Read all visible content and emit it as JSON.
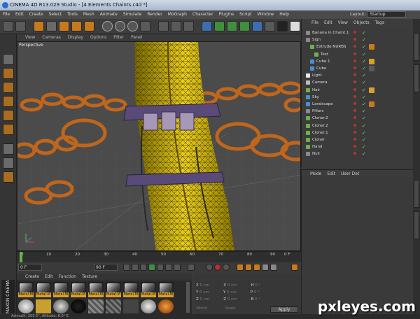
{
  "window": {
    "title": "CINEMA 4D R13.029 Studio - [4 Elements Chaints.c4d *]"
  },
  "menu": [
    "File",
    "Edit",
    "Create",
    "Select",
    "Tools",
    "Mesh",
    "Animate",
    "Simulate",
    "Render",
    "MoGraph",
    "Character",
    "Plugins",
    "Script",
    "Window",
    "Help"
  ],
  "layout": {
    "label": "Layout:",
    "value": "Startup"
  },
  "viewport": {
    "menu": [
      "View",
      "Cameras",
      "Display",
      "Options",
      "Filter",
      "Panel"
    ],
    "label": "Perspective"
  },
  "timeline": {
    "ticks": [
      "0",
      "10",
      "20",
      "30",
      "40",
      "50",
      "60",
      "70",
      "80",
      "90"
    ],
    "current": "0 F"
  },
  "transport": {
    "start": "0 F",
    "end": "90 F",
    "current": "90 F"
  },
  "materials": {
    "menu": [
      "Create",
      "Edit",
      "Function",
      "Texture"
    ],
    "items": [
      "Metal-M",
      "Metal-M",
      "Metal-M",
      "Metal-M",
      "Metal-M",
      "Metal-M",
      "Metal-M",
      "Metal-M",
      "Metal-M"
    ]
  },
  "coordinates": {
    "rows": [
      {
        "a": "X",
        "av": "0 cm",
        "b": "X",
        "bv": "0 cm",
        "c": "H",
        "cv": "0 °"
      },
      {
        "a": "Y",
        "av": "0 cm",
        "b": "Y",
        "bv": "0 cm",
        "c": "P",
        "cv": "0 °"
      },
      {
        "a": "Z",
        "av": "0 cm",
        "b": "Z",
        "bv": "0 cm",
        "c": "B",
        "cv": "0 °"
      }
    ],
    "mode1": "World",
    "mode2": "Scale",
    "apply": "Apply"
  },
  "objectManager": {
    "menu": [
      "File",
      "Edit",
      "View",
      "Objects",
      "Tags"
    ],
    "items": [
      {
        "name": "Banana in Chaint.1",
        "indent": 0,
        "color": "#8a8a8a"
      },
      {
        "name": "Sign",
        "indent": 0,
        "color": "#8a8a8a"
      },
      {
        "name": "Extrude NURBS",
        "indent": 1,
        "color": "#6cb04b"
      },
      {
        "name": "Text",
        "indent": 2,
        "color": "#6cb04b"
      },
      {
        "name": "Cube.1",
        "indent": 1,
        "color": "#4a8fd0"
      },
      {
        "name": "Cube",
        "indent": 1,
        "color": "#4a8fd0"
      },
      {
        "name": "Light",
        "indent": 0,
        "color": "#e8e8e8"
      },
      {
        "name": "Camera",
        "indent": 0,
        "color": "#bbbbbb"
      },
      {
        "name": "Hair",
        "indent": 0,
        "color": "#6cb04b"
      },
      {
        "name": "Sky",
        "indent": 0,
        "color": "#4a8fd0"
      },
      {
        "name": "Landscape",
        "indent": 0,
        "color": "#4a8fd0"
      },
      {
        "name": "Pillars",
        "indent": 0,
        "color": "#8a8a8a"
      },
      {
        "name": "Cloner.2",
        "indent": 0,
        "color": "#6cb04b"
      },
      {
        "name": "Cloner.2",
        "indent": 0,
        "color": "#6cb04b"
      },
      {
        "name": "Cloner.1",
        "indent": 0,
        "color": "#6cb04b"
      },
      {
        "name": "Cloner",
        "indent": 0,
        "color": "#6cb04b"
      },
      {
        "name": "Hand",
        "indent": 0,
        "color": "#6cb04b"
      },
      {
        "name": "Null",
        "indent": 0,
        "color": "#8a8a8a"
      }
    ]
  },
  "attributes": {
    "menu": [
      "Mode",
      "Edit",
      "User Dat"
    ]
  },
  "status": {
    "text": "Azimuth: 205.5°, Altitude: 6.0°  E"
  },
  "branding": {
    "vendor": "MAXON",
    "product": "CINEMA 4D"
  },
  "watermark": "pxleyes.com"
}
